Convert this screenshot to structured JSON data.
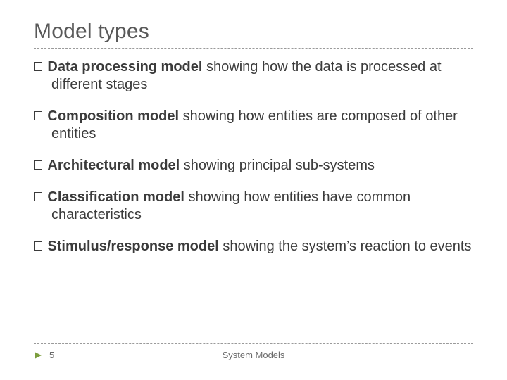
{
  "slide": {
    "title": "Model types",
    "items": [
      {
        "bold": "Data processing model",
        "rest": " showing how the data is processed at different stages"
      },
      {
        "bold": "Composition model",
        "rest": " showing how entities are composed of other entities"
      },
      {
        "bold": "Architectural model",
        "rest": " showing principal sub-systems"
      },
      {
        "bold": "Classification model",
        "rest": " showing how entities have common characteristics"
      },
      {
        "bold": "Stimulus/response model",
        "rest": " showing the system’s reaction to events"
      }
    ]
  },
  "footer": {
    "page_number": "5",
    "label": "System Models"
  },
  "icons": {
    "bullet": "hollow-square-icon",
    "play": "play-triangle-icon"
  },
  "colors": {
    "title": "#595959",
    "body": "#3b3b3b",
    "rule": "#9a9a9a",
    "play": "#7c9e3e"
  }
}
